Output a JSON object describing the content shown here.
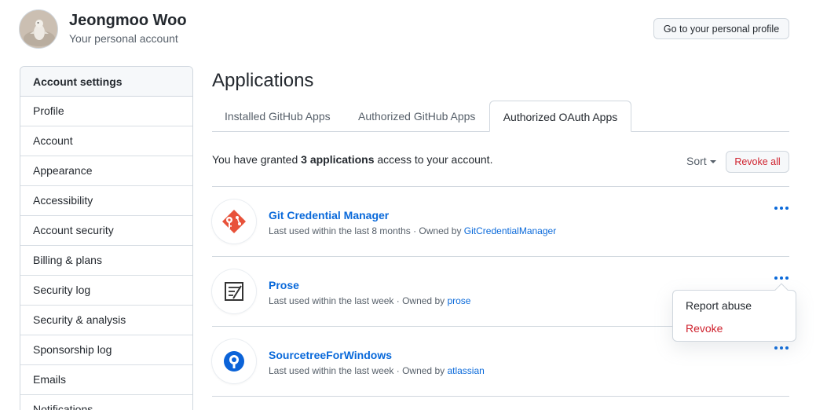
{
  "user": {
    "name": "Jeongmoo Woo",
    "subtitle": "Your personal account",
    "profile_button": "Go to your personal profile"
  },
  "sidebar": {
    "heading": "Account settings",
    "items": [
      {
        "label": "Profile"
      },
      {
        "label": "Account"
      },
      {
        "label": "Appearance"
      },
      {
        "label": "Accessibility"
      },
      {
        "label": "Account security"
      },
      {
        "label": "Billing & plans"
      },
      {
        "label": "Security log"
      },
      {
        "label": "Security & analysis"
      },
      {
        "label": "Sponsorship log"
      },
      {
        "label": "Emails"
      },
      {
        "label": "Notifications"
      }
    ]
  },
  "main": {
    "title": "Applications",
    "tabs": [
      {
        "label": "Installed GitHub Apps"
      },
      {
        "label": "Authorized GitHub Apps"
      },
      {
        "label": "Authorized OAuth Apps",
        "selected": true
      }
    ],
    "granted_prefix": "You have granted ",
    "granted_count": "3 applications",
    "granted_suffix": " access to your account.",
    "sort_label": "Sort",
    "revoke_all_label": "Revoke all",
    "apps": [
      {
        "name": "Git Credential Manager",
        "usage": "Last used within the last 8 months · Owned by ",
        "owner": "GitCredentialManager",
        "icon": "git-credential-manager-icon"
      },
      {
        "name": "Prose",
        "usage": "Last used within the last week · Owned by ",
        "owner": "prose",
        "icon": "prose-icon"
      },
      {
        "name": "SourcetreeForWindows",
        "usage": "Last used within the last week · Owned by ",
        "owner": "atlassian",
        "icon": "sourcetree-icon"
      }
    ],
    "menu": {
      "report_abuse": "Report abuse",
      "revoke": "Revoke"
    }
  },
  "colors": {
    "link": "#0969da",
    "danger": "#cf222e",
    "border": "#d0d7de",
    "muted": "#57606a"
  }
}
